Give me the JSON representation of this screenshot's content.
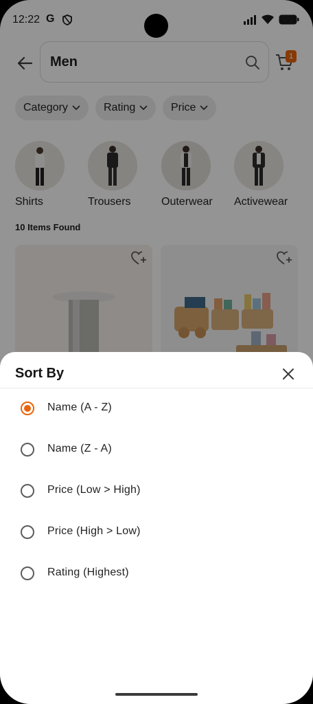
{
  "status_bar": {
    "time": "12:22",
    "g_icon": "G"
  },
  "search": {
    "value": "Men"
  },
  "cart": {
    "badge_count": "1"
  },
  "filters": [
    {
      "label": "Category"
    },
    {
      "label": "Rating"
    },
    {
      "label": "Price"
    }
  ],
  "categories": [
    {
      "label": "Shirts"
    },
    {
      "label": "Trousers"
    },
    {
      "label": "Outerwear"
    },
    {
      "label": "Activewear"
    }
  ],
  "results": {
    "count_text": "10 Items Found"
  },
  "sort_sheet": {
    "title": "Sort By",
    "options": [
      {
        "label": "Name (A - Z)",
        "selected": true
      },
      {
        "label": "Name (Z - A)",
        "selected": false
      },
      {
        "label": "Price (Low > High)",
        "selected": false
      },
      {
        "label": "Price (High > Low)",
        "selected": false
      },
      {
        "label": "Rating (Highest)",
        "selected": false
      }
    ]
  },
  "colors": {
    "accent": "#e8650c",
    "scrim": "rgba(0,0,0,0.42)"
  }
}
